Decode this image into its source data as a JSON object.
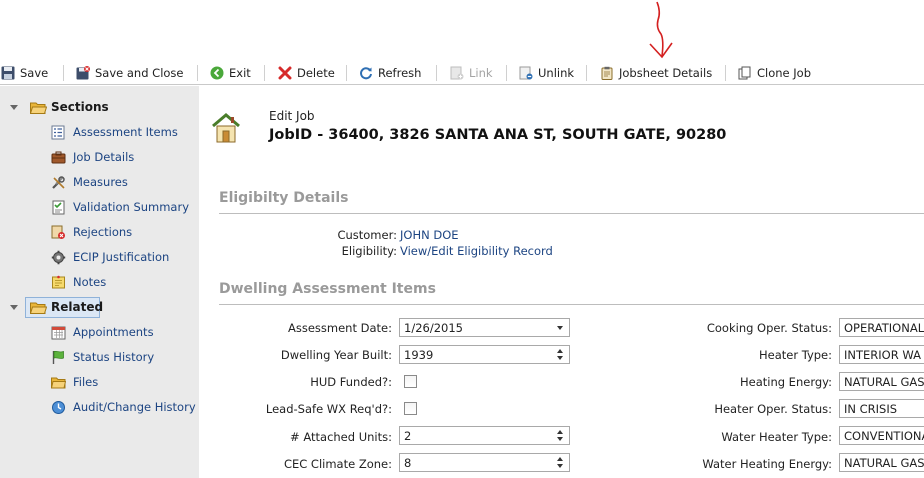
{
  "toolbar": {
    "save": "Save",
    "save_close": "Save and Close",
    "exit": "Exit",
    "delete": "Delete",
    "refresh": "Refresh",
    "link": "Link",
    "unlink": "Unlink",
    "jobsheet_details": "Jobsheet Details",
    "clone_job": "Clone Job"
  },
  "sidebar": {
    "sections_label": "Sections",
    "sections": [
      {
        "label": "Assessment Items",
        "icon": "list-icon"
      },
      {
        "label": "Job Details",
        "icon": "briefcase-icon"
      },
      {
        "label": "Measures",
        "icon": "tools-icon"
      },
      {
        "label": "Validation Summary",
        "icon": "checklist-icon"
      },
      {
        "label": "Rejections",
        "icon": "rejection-icon"
      },
      {
        "label": "ECIP Justification",
        "icon": "gear-icon"
      },
      {
        "label": "Notes",
        "icon": "note-icon"
      }
    ],
    "related_label": "Related",
    "related": [
      {
        "label": "Appointments",
        "icon": "calendar-icon"
      },
      {
        "label": "Status History",
        "icon": "flag-icon"
      },
      {
        "label": "Files",
        "icon": "folder-icon"
      },
      {
        "label": "Audit/Change History",
        "icon": "history-icon"
      }
    ]
  },
  "header": {
    "edit_label": "Edit Job",
    "title": "JobID - 36400, 3826 SANTA ANA ST, SOUTH GATE, 90280"
  },
  "eligibility": {
    "heading": "Eligibilty Details",
    "customer_label": "Customer:",
    "customer_value": "JOHN DOE",
    "eligibility_label": "Eligibility:",
    "eligibility_value": "View/Edit Eligibility Record"
  },
  "dwelling": {
    "heading": "Dwelling Assessment Items",
    "left": [
      {
        "label": "Assessment Date:",
        "value": "1/26/2015",
        "type": "dropdown"
      },
      {
        "label": "Dwelling Year Built:",
        "value": "1939",
        "type": "spinner"
      },
      {
        "label": "HUD Funded?:",
        "value": "",
        "type": "checkbox",
        "checked": false
      },
      {
        "label": "Lead-Safe WX Req'd?:",
        "value": "",
        "type": "checkbox",
        "checked": false
      },
      {
        "label": "# Attached Units:",
        "value": "2",
        "type": "spinner"
      },
      {
        "label": "CEC Climate Zone:",
        "value": "8",
        "type": "spinner"
      }
    ],
    "right": [
      {
        "label": "Cooking Oper. Status:",
        "value": "OPERATIONAL"
      },
      {
        "label": "Heater Type:",
        "value": "INTERIOR WA"
      },
      {
        "label": "Heating Energy:",
        "value": "NATURAL GAS"
      },
      {
        "label": "Heater Oper. Status:",
        "value": "IN CRISIS"
      },
      {
        "label": "Water Heater Type:",
        "value": "CONVENTIONA"
      },
      {
        "label": "Water Heating Energy:",
        "value": "NATURAL GAS"
      }
    ]
  },
  "colors": {
    "link": "#1c4482",
    "section_heading": "#9a9a9a",
    "sidebar_bg": "#eaeaea",
    "annotation_arrow": "#d42020"
  }
}
